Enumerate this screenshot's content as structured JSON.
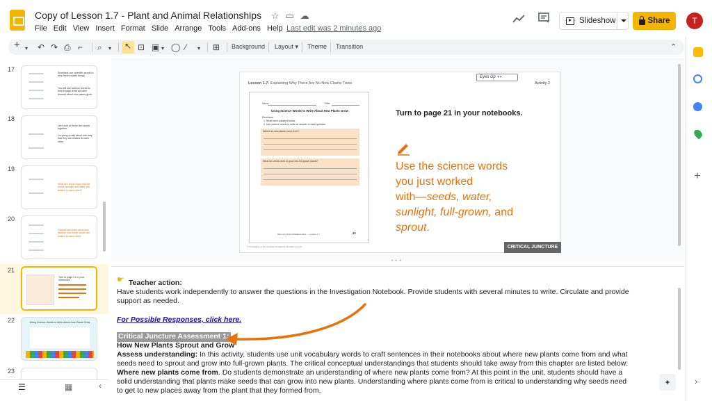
{
  "app": {
    "doc_title": "Copy of Lesson 1.7 - Plant and Animal Relationships",
    "menu": [
      "File",
      "Edit",
      "View",
      "Insert",
      "Format",
      "Slide",
      "Arrange",
      "Tools",
      "Add-ons",
      "Help"
    ],
    "last_edit": "Last edit was 2 minutes ago",
    "slideshow_label": "Slideshow",
    "share_label": "Share",
    "avatar_initial": "T"
  },
  "toolbar": {
    "background": "Background",
    "layout": "Layout",
    "theme": "Theme",
    "transition": "Transition"
  },
  "filmstrip": {
    "slides": [
      {
        "num": "17",
        "texts": [
          "Scientists use scientific words to help them explain things.",
          "You will use science words to help explain what we have learned about how plants grow."
        ]
      },
      {
        "num": "18",
        "texts": [
          "Let's look at these two words together.",
          "I'm going to talk about one way that they are related to each other."
        ]
      },
      {
        "num": "19",
        "texts": [
          "What are some ways that the words sunlight and water are related to each other?"
        ]
      },
      {
        "num": "20",
        "texts": [
          "Choose two word cards and discuss how these words are related to each other."
        ]
      },
      {
        "num": "21",
        "texts": [
          "Turn to page 21 in your notebooks."
        ]
      },
      {
        "num": "22",
        "texts": [
          "Using Science Words to Write About How Plants Grow"
        ]
      },
      {
        "num": "23",
        "texts": []
      }
    ]
  },
  "slide": {
    "header_left_bold": "Lesson 1.7:",
    "header_left": "Explaining Why There Are No New Chaha Trees",
    "eyes_up": "Eyes Up",
    "activity": "Activity 2",
    "worksheet": {
      "name_label": "Name:",
      "date_label": "Date:",
      "title": "Using Science Words to Write About How Plants Grow",
      "directions": "Directions:",
      "dir1": "1. Read each question below.",
      "dir2": "2. Use science words to write an answer to each question.",
      "q1": "Where do new plants come from?",
      "q2": "What do seeds need to grow into full-grown plants?",
      "footer": "Plant and Animal Relationships — Lesson 1.7",
      "page": "21",
      "copyright": "© The Regents of the University of California. All rights reserved."
    },
    "instruction": "Turn to page 21 in your notebooks.",
    "use_line1": "Use the science words",
    "use_line2": "you just worked",
    "use_line3_pre": "with—",
    "use_line3_ital": "seeds, water,",
    "use_line4_ital": "sunlight, full-grown,",
    "use_line4_post": " and",
    "use_line5_ital": "sprout",
    "use_line5_post": ".",
    "badge": "CRITICAL JUNCTURE"
  },
  "notes": {
    "teacher_action": "Teacher action:",
    "p1_line1": "Have students work independently to answer the questions in the Investigation Notebook. Provide students with several minutes to write. Circulate and provide",
    "p1_line2": "support as needed.",
    "link": "For Possible Responses, click here.",
    "cj_heading": "Critical Juncture Assessment 1:",
    "cj_subheading": "How New Plants Sprout and Grow",
    "assess_label": "Assess understanding:",
    "assess_line1": " In this activity, students use unit vocabulary words to craft sentences in their notebooks about where new plants come from and what",
    "assess_line2": "seeds need to sprout and grow into full-grown plants. The critical conceptual understandings that students should take away from this chapter are listed below:",
    "where_label": "Where new plants come from",
    "where_line1": ". Do students demonstrate an understanding of where new plants come from? At this point in the unit, students should have a",
    "where_line2": "solid understanding that plants make seeds that can grow into new plants. Understanding where plants come from is critical to understanding why seeds need",
    "where_line3": "to get to new places away from the plant that they formed from."
  },
  "colors": {
    "accent": "#f4b400",
    "orange": "#e8710a",
    "link": "#1a0dab"
  }
}
